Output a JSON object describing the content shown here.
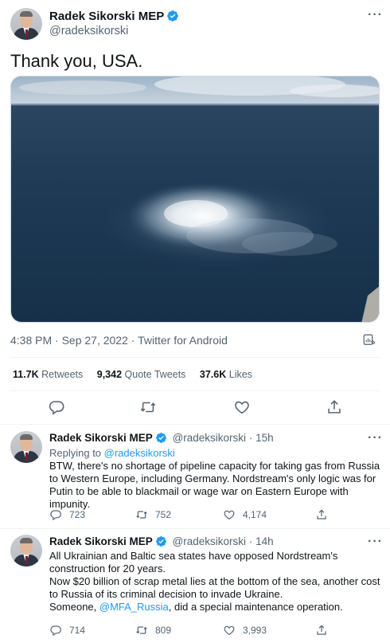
{
  "main_tweet": {
    "author_name": "Radek Sikorski MEP",
    "author_handle": "@radeksikorski",
    "text": "Thank you, USA.",
    "timestamp": "4:38 PM · Sep 27, 2022",
    "source": "Twitter for Android",
    "media_description": "aerial photo of gas bubbling on sea surface",
    "stats": [
      {
        "count": "11.7K",
        "label": "Retweets"
      },
      {
        "count": "9,342",
        "label": "Quote Tweets"
      },
      {
        "count": "37.6K",
        "label": "Likes"
      }
    ],
    "actions": [
      "reply-icon",
      "retweet-icon",
      "like-icon",
      "share-icon"
    ]
  },
  "replies": [
    {
      "author_name": "Radek Sikorski MEP",
      "author_handle": "@radeksikorski",
      "time": "15h",
      "replying_label": "Replying to",
      "replying_to": "@radeksikorski",
      "text": "BTW, there's no shortage of pipeline capacity for taking gas from Russia to Western Europe, including Germany. Nordstream's only logic was for Putin to be able to blackmail or wage war on Eastern Europe with impunity.",
      "reply_count": "723",
      "retweet_count": "752",
      "like_count": "4,174"
    },
    {
      "author_name": "Radek Sikorski MEP",
      "author_handle": "@radeksikorski",
      "time": "14h",
      "text_lines": [
        "All Ukrainian and Baltic sea states have opposed Nordstream's construction for 20 years.",
        "Now $20 billion of scrap metal lies at the bottom of the sea, another cost to Russia of its criminal decision to invade Ukraine."
      ],
      "text_last_prefix": "Someone, ",
      "mention": "@MFA_Russia",
      "text_last_suffix": ", did a special maintenance operation.",
      "reply_count": "714",
      "retweet_count": "809",
      "like_count": "3,993"
    }
  ],
  "colors": {
    "link": "#1d9bf0",
    "secondary_text": "#536471",
    "verified": "#1d9bf0"
  }
}
